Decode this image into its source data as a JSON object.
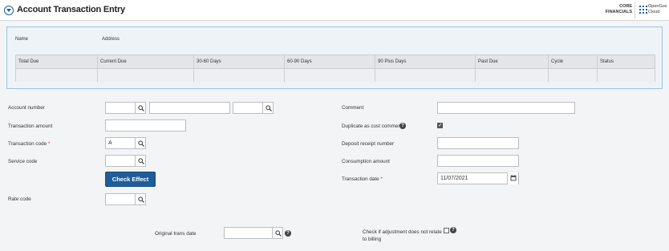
{
  "header": {
    "title": "Account Transaction Entry",
    "product": "CORE FINANCIALS",
    "vendor": "OpenGov Cloud",
    "accent_color": "#1f5d9a"
  },
  "summary": {
    "name_label": "Name",
    "address_label": "Address",
    "columns": [
      "Total Due",
      "Current Due",
      "30-60 Days",
      "60-90 Days",
      "90 Plus Days",
      "Past Due",
      "Cycle",
      "Status"
    ]
  },
  "form": {
    "account_number": {
      "label": "Account number",
      "value1": "",
      "value2": "",
      "value3": ""
    },
    "transaction_amount": {
      "label": "Transaction amount",
      "value": ""
    },
    "transaction_code": {
      "label": "Transaction code",
      "required_mark": "*",
      "value": "A"
    },
    "service_code": {
      "label": "Service code",
      "value": ""
    },
    "check_effect_label": "Check Effect",
    "rate_code": {
      "label": "Rate code",
      "value": ""
    },
    "comment": {
      "label": "Comment",
      "value": ""
    },
    "duplicate_comment": {
      "label": "Duplicate as cust comment?",
      "checked": true
    },
    "deposit_receipt": {
      "label": "Deposit receipt number",
      "value": ""
    },
    "consumption_amount": {
      "label": "Consumption amount",
      "value": ""
    },
    "transaction_date": {
      "label": "Transaction date",
      "required_mark": "*",
      "value": "11/07/2021"
    },
    "original_trans_date": {
      "label": "Original trans date",
      "value": ""
    },
    "adjustment_check": {
      "label_line1": "Check if adjustment does not relate",
      "label_line2": "to billing",
      "checked": false
    }
  },
  "icons": {
    "lookup": "magnifier-icon",
    "help": "question-circle-icon",
    "calendar": "calendar-icon",
    "apps": "grid-icon"
  }
}
